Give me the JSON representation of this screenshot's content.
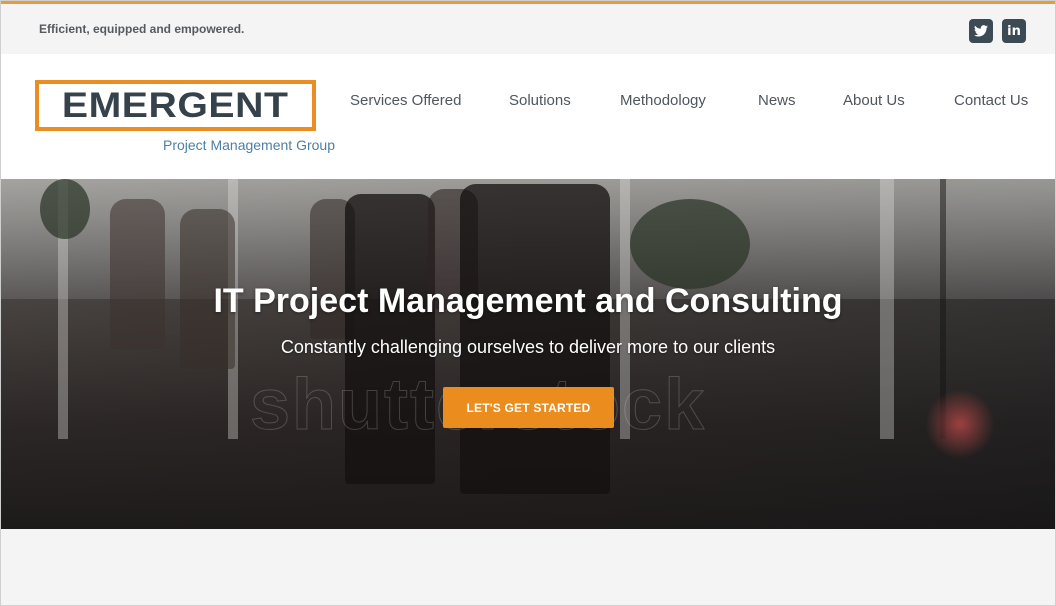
{
  "topbar": {
    "tagline": "Efficient, equipped and empowered.",
    "social": [
      {
        "icon": "twitter-icon",
        "label": ""
      },
      {
        "icon": "linkedin-icon",
        "label": "in"
      }
    ]
  },
  "logo": {
    "wordmark": "EMERGENT",
    "subtitle": "Project Management Group"
  },
  "nav": {
    "items": [
      {
        "label": "Services Offered"
      },
      {
        "label": "Solutions"
      },
      {
        "label": "Methodology"
      },
      {
        "label": "News"
      },
      {
        "label": "About Us"
      },
      {
        "label": "Contact Us"
      }
    ]
  },
  "hero": {
    "title": "IT Project Management and Consulting",
    "subtitle": "Constantly challenging ourselves to deliver more to our clients",
    "cta_label": "LET'S GET STARTED",
    "watermark": "shutterstock"
  },
  "colors": {
    "accent": "#ea8d1e",
    "top_border": "#ea9a3a",
    "logo_text": "#35414b",
    "social_bg": "#3c4a56"
  }
}
